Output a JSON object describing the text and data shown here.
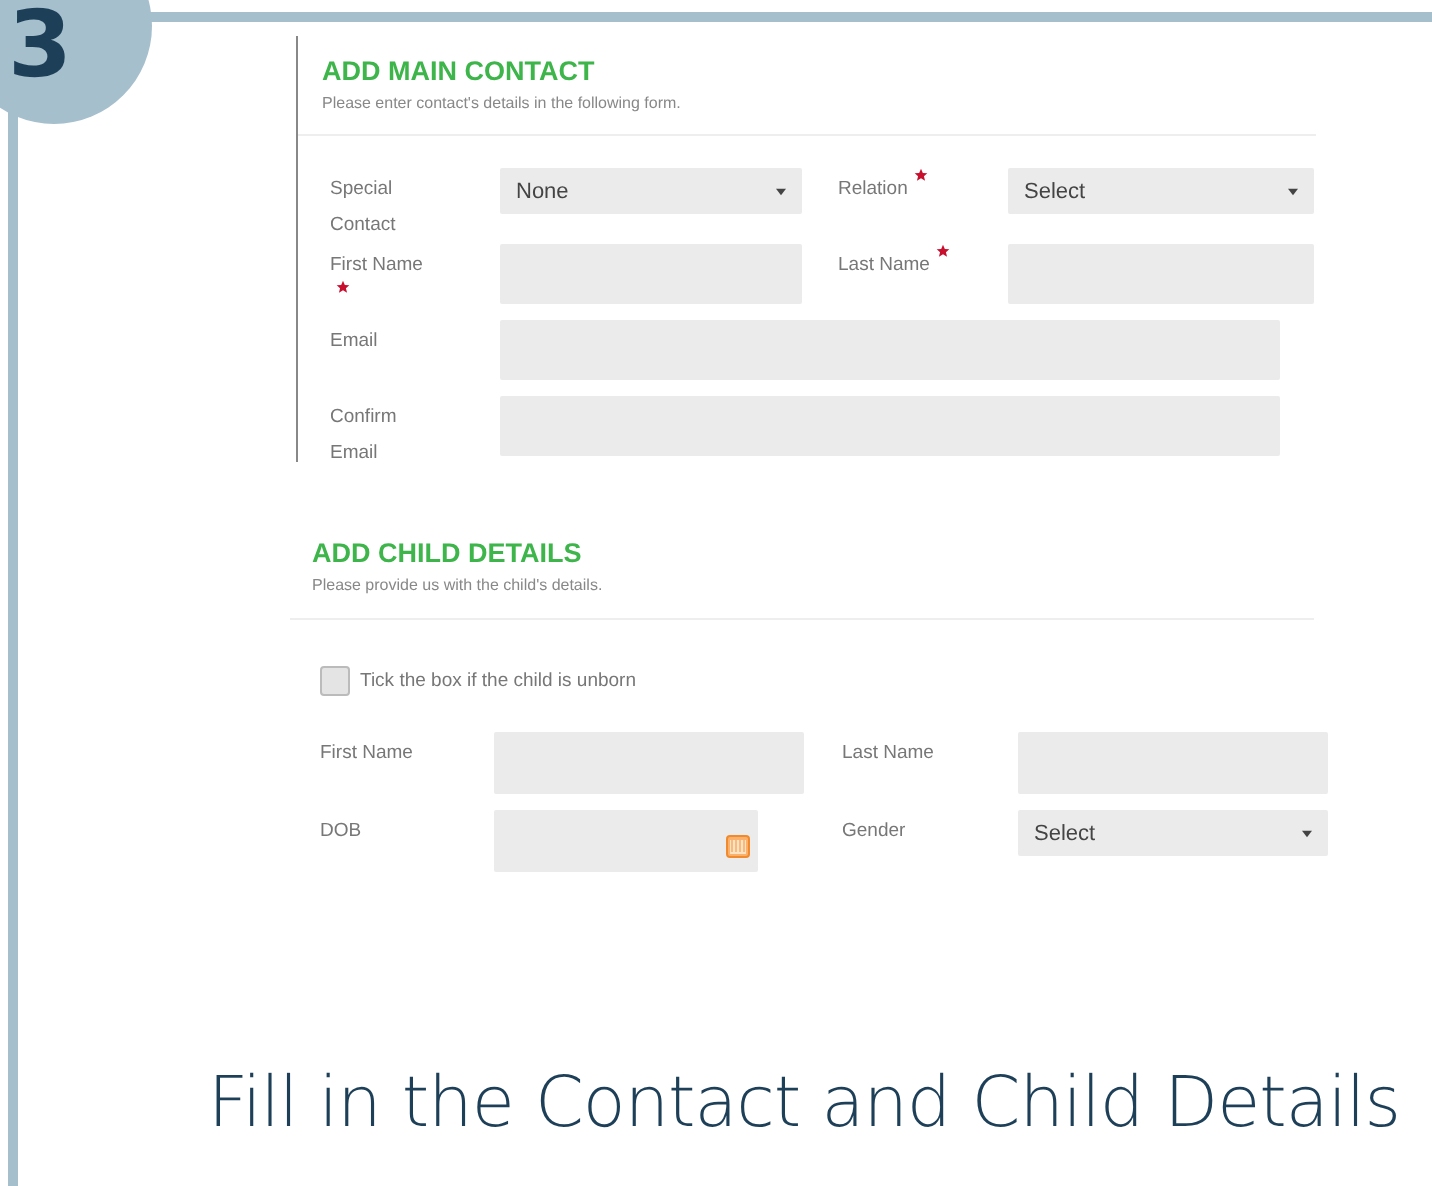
{
  "step": "3",
  "main_contact": {
    "title": "ADD MAIN CONTACT",
    "subtitle": "Please enter contact's details in the following form.",
    "rows": [
      {
        "fields": [
          {
            "label": "Special Contact",
            "required": false,
            "kind": "select",
            "value": "None"
          },
          {
            "label": "Relation",
            "required": true,
            "kind": "select",
            "value": "Select"
          }
        ]
      },
      {
        "fields": [
          {
            "label": "First Name",
            "required": true,
            "kind": "text"
          },
          {
            "label": "Last Name",
            "required": true,
            "kind": "text"
          }
        ]
      },
      {
        "fields": [
          {
            "label": "Email",
            "required": false,
            "kind": "wide"
          }
        ]
      },
      {
        "fields": [
          {
            "label": "Confirm Email",
            "required": false,
            "kind": "wide"
          }
        ]
      }
    ]
  },
  "child_details": {
    "title": "ADD CHILD DETAILS",
    "subtitle": "Please provide us with the child's details.",
    "checkbox": {
      "label": "Tick the box if the child is unborn",
      "checked": false
    },
    "rows": [
      {
        "fields": [
          {
            "label": "First Name",
            "required": false,
            "kind": "text"
          },
          {
            "label": "Last Name",
            "required": false,
            "kind": "text"
          }
        ]
      },
      {
        "fields": [
          {
            "label": "DOB",
            "required": false,
            "kind": "date"
          },
          {
            "label": "Gender",
            "required": false,
            "kind": "select",
            "value": "Select"
          }
        ]
      }
    ]
  },
  "caption": "Fill in the Contact and Child Details"
}
